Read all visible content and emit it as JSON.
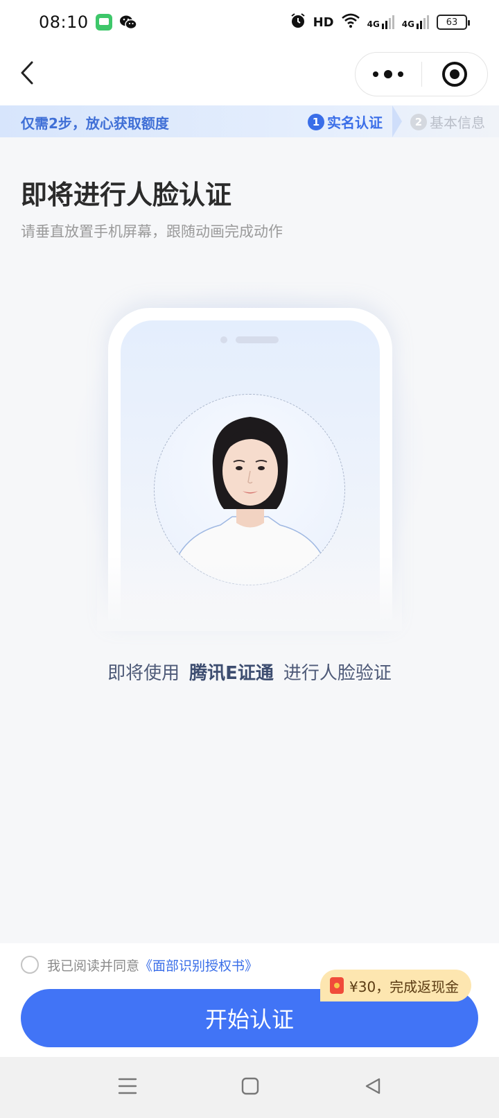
{
  "status_bar": {
    "time": "08:10",
    "hd_label": "HD",
    "signal1_label": "4G",
    "signal2_label": "4G",
    "battery_level": "63",
    "icons": [
      "messages-app-icon",
      "wechat-icon",
      "alarm-icon",
      "hd-icon",
      "wifi-icon",
      "signal-4g-icon",
      "signal-4g-icon",
      "battery-icon"
    ]
  },
  "nav": {
    "back_icon": "chevron-left-icon",
    "more_icon": "more-dots-icon",
    "close_icon": "target-close-icon"
  },
  "steps": {
    "tagline": "仅需2步，放心获取额度",
    "items": [
      {
        "num": "1",
        "label": "实名认证",
        "active": true
      },
      {
        "num": "2",
        "label": "基本信息",
        "active": false
      }
    ]
  },
  "main": {
    "title": "即将进行人脸认证",
    "subtitle": "请垂直放置手机屏幕，跟随动画完成动作",
    "provider_prefix": "即将使用",
    "provider_name": "腾讯E证通",
    "provider_suffix": "进行人脸验证"
  },
  "footer": {
    "agree_prefix": "我已阅读并同意",
    "agree_link": "《面部识别授权书》",
    "start_button": "开始认证",
    "promo": "¥30，完成返现金"
  },
  "colors": {
    "accent": "#4174f6",
    "link": "#3a6ee8",
    "promo_bg": "#fde6b0"
  }
}
